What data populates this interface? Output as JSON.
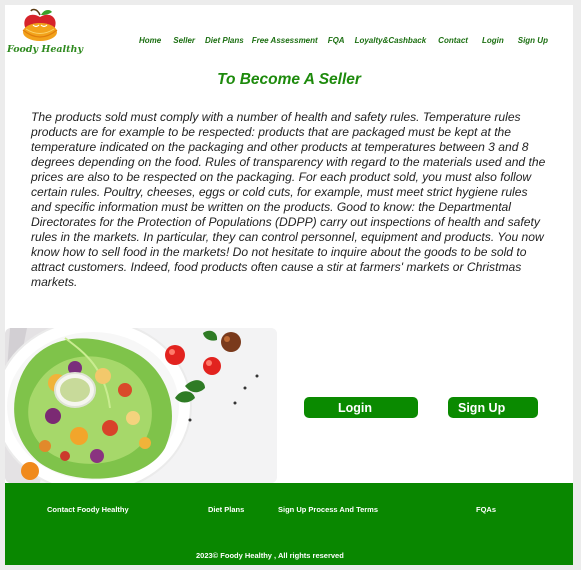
{
  "brand": {
    "name": "Foody Healthy"
  },
  "nav": {
    "items": [
      {
        "label": "Home"
      },
      {
        "label": "Seller"
      },
      {
        "label": "Diet Plans"
      },
      {
        "label": "Free Assessment"
      },
      {
        "label": "FQA"
      },
      {
        "label": "Loyalty&Cashback"
      },
      {
        "label": "Contact"
      },
      {
        "label": "Login"
      },
      {
        "label": "Sign Up"
      }
    ]
  },
  "main": {
    "title": "To Become A Seller",
    "body": "The products sold must comply with a number of health and safety rules. Temperature rules products are for example to be respected: products that are packaged must be kept at the temperature indicated on the packaging and other products at temperatures between 3 and 8 degrees depending on the food. Rules of transparency with regard to the materials used and the prices are also to be respected on the packaging. For each product sold, you must also follow certain rules. Poultry, cheeses, eggs or cold cuts, for example, must meet strict hygiene rules and specific information must be written on the products. Good to know: the Departmental Directorates for the Protection of Populations (DDPP) carry out inspections of health and safety rules in the markets. In particular, they can control personnel, equipment and products. You now know how to sell food in the markets! Do not hesitate to inquire about the goods to be sold to attract customers. Indeed, food products often cause a stir at farmers' markets or Christmas markets.",
    "login_label": "Login",
    "signup_label": "Sign Up"
  },
  "footer": {
    "links": [
      {
        "label": "Contact Foody Healthy"
      },
      {
        "label": "Diet Plans"
      },
      {
        "label": "Sign Up Process And Terms"
      },
      {
        "label": "FQAs"
      }
    ],
    "copyright": "2023© Foody Healthy , All rights reserved"
  },
  "colors": {
    "brand_green": "#098700",
    "title_green": "#1d8a0c",
    "nav_green": "#1c6f12"
  }
}
